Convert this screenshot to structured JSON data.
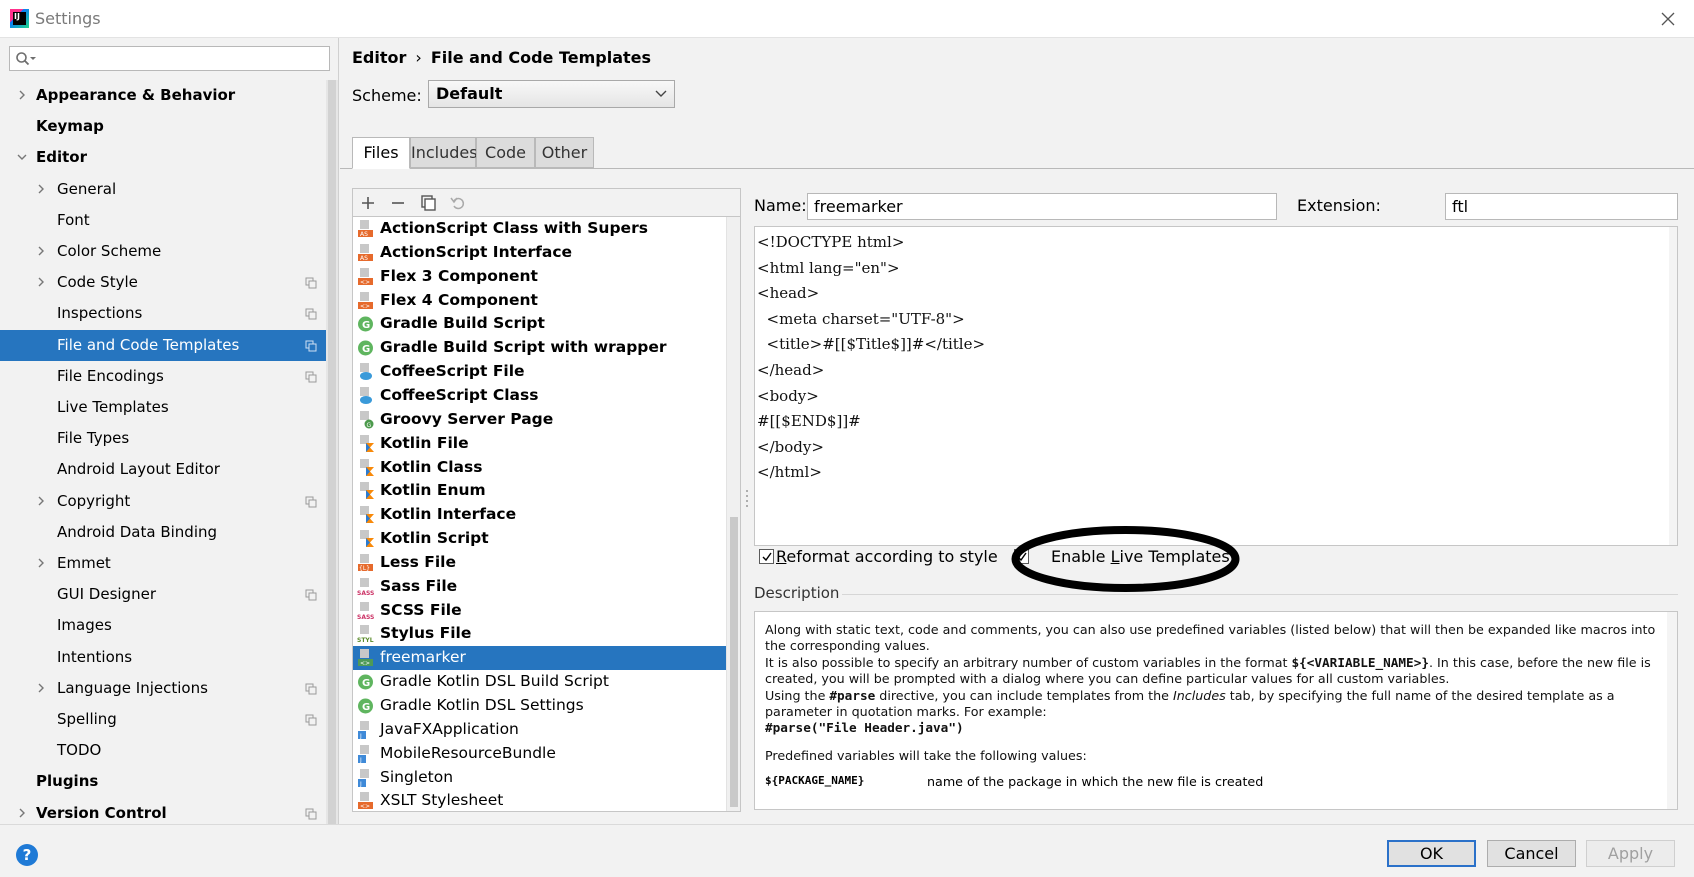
{
  "window": {
    "title": "Settings"
  },
  "search": {
    "placeholder": ""
  },
  "sidebar": {
    "items": [
      {
        "label": "Appearance & Behavior",
        "level": 0,
        "arrow": "right",
        "bold": true,
        "scoped": false,
        "selected": false
      },
      {
        "label": "Keymap",
        "level": 0,
        "arrow": "",
        "bold": true,
        "scoped": false,
        "selected": false
      },
      {
        "label": "Editor",
        "level": 0,
        "arrow": "down",
        "bold": true,
        "scoped": false,
        "selected": false
      },
      {
        "label": "General",
        "level": 1,
        "arrow": "right",
        "bold": false,
        "scoped": false,
        "selected": false
      },
      {
        "label": "Font",
        "level": 1,
        "arrow": "",
        "bold": false,
        "scoped": false,
        "selected": false
      },
      {
        "label": "Color Scheme",
        "level": 1,
        "arrow": "right",
        "bold": false,
        "scoped": false,
        "selected": false
      },
      {
        "label": "Code Style",
        "level": 1,
        "arrow": "right",
        "bold": false,
        "scoped": true,
        "selected": false
      },
      {
        "label": "Inspections",
        "level": 1,
        "arrow": "",
        "bold": false,
        "scoped": true,
        "selected": false
      },
      {
        "label": "File and Code Templates",
        "level": 1,
        "arrow": "",
        "bold": false,
        "scoped": true,
        "selected": true
      },
      {
        "label": "File Encodings",
        "level": 1,
        "arrow": "",
        "bold": false,
        "scoped": true,
        "selected": false
      },
      {
        "label": "Live Templates",
        "level": 1,
        "arrow": "",
        "bold": false,
        "scoped": false,
        "selected": false
      },
      {
        "label": "File Types",
        "level": 1,
        "arrow": "",
        "bold": false,
        "scoped": false,
        "selected": false
      },
      {
        "label": "Android Layout Editor",
        "level": 1,
        "arrow": "",
        "bold": false,
        "scoped": false,
        "selected": false
      },
      {
        "label": "Copyright",
        "level": 1,
        "arrow": "right",
        "bold": false,
        "scoped": true,
        "selected": false
      },
      {
        "label": "Android Data Binding",
        "level": 1,
        "arrow": "",
        "bold": false,
        "scoped": false,
        "selected": false
      },
      {
        "label": "Emmet",
        "level": 1,
        "arrow": "right",
        "bold": false,
        "scoped": false,
        "selected": false
      },
      {
        "label": "GUI Designer",
        "level": 1,
        "arrow": "",
        "bold": false,
        "scoped": true,
        "selected": false
      },
      {
        "label": "Images",
        "level": 1,
        "arrow": "",
        "bold": false,
        "scoped": false,
        "selected": false
      },
      {
        "label": "Intentions",
        "level": 1,
        "arrow": "",
        "bold": false,
        "scoped": false,
        "selected": false
      },
      {
        "label": "Language Injections",
        "level": 1,
        "arrow": "right",
        "bold": false,
        "scoped": true,
        "selected": false
      },
      {
        "label": "Spelling",
        "level": 1,
        "arrow": "",
        "bold": false,
        "scoped": true,
        "selected": false
      },
      {
        "label": "TODO",
        "level": 1,
        "arrow": "",
        "bold": false,
        "scoped": false,
        "selected": false
      },
      {
        "label": "Plugins",
        "level": 0,
        "arrow": "",
        "bold": true,
        "scoped": false,
        "selected": false
      },
      {
        "label": "Version Control",
        "level": 0,
        "arrow": "right",
        "bold": true,
        "scoped": true,
        "selected": false
      }
    ]
  },
  "breadcrumb": {
    "parent": "Editor",
    "separator": "›",
    "current": "File and Code Templates"
  },
  "scheme": {
    "label": "Scheme:",
    "value": "Default"
  },
  "tabs": [
    {
      "label": "Files",
      "active": true
    },
    {
      "label": "Includes",
      "active": false
    },
    {
      "label": "Code",
      "active": false
    },
    {
      "label": "Other",
      "active": false
    }
  ],
  "templates": [
    {
      "name": "ActionScript Class with Supers",
      "icon": "actionscript-icon",
      "bold": true,
      "selected": false
    },
    {
      "name": "ActionScript Interface",
      "icon": "actionscript-icon",
      "bold": true,
      "selected": false
    },
    {
      "name": "Flex 3 Component",
      "icon": "flex-icon",
      "bold": true,
      "selected": false
    },
    {
      "name": "Flex 4 Component",
      "icon": "flex-icon",
      "bold": true,
      "selected": false
    },
    {
      "name": "Gradle Build Script",
      "icon": "gradle-icon",
      "bold": true,
      "selected": false
    },
    {
      "name": "Gradle Build Script with wrapper",
      "icon": "gradle-icon",
      "bold": true,
      "selected": false
    },
    {
      "name": "CoffeeScript File",
      "icon": "coffeescript-icon",
      "bold": true,
      "selected": false
    },
    {
      "name": "CoffeeScript Class",
      "icon": "coffeescript-icon",
      "bold": true,
      "selected": false
    },
    {
      "name": "Groovy Server Page",
      "icon": "groovy-icon",
      "bold": true,
      "selected": false
    },
    {
      "name": "Kotlin File",
      "icon": "kotlin-icon",
      "bold": true,
      "selected": false
    },
    {
      "name": "Kotlin Class",
      "icon": "kotlin-icon",
      "bold": true,
      "selected": false
    },
    {
      "name": "Kotlin Enum",
      "icon": "kotlin-icon",
      "bold": true,
      "selected": false
    },
    {
      "name": "Kotlin Interface",
      "icon": "kotlin-icon",
      "bold": true,
      "selected": false
    },
    {
      "name": "Kotlin Script",
      "icon": "kotlin-icon",
      "bold": true,
      "selected": false
    },
    {
      "name": "Less File",
      "icon": "less-icon",
      "bold": true,
      "selected": false
    },
    {
      "name": "Sass File",
      "icon": "sass-icon",
      "bold": true,
      "selected": false
    },
    {
      "name": "SCSS File",
      "icon": "sass-icon",
      "bold": true,
      "selected": false
    },
    {
      "name": "Stylus File",
      "icon": "stylus-icon",
      "bold": true,
      "selected": false
    },
    {
      "name": "freemarker",
      "icon": "template-icon",
      "bold": false,
      "selected": true
    },
    {
      "name": "Gradle Kotlin DSL Build Script",
      "icon": "gradle-icon",
      "bold": false,
      "selected": false
    },
    {
      "name": "Gradle Kotlin DSL Settings",
      "icon": "gradle-icon",
      "bold": false,
      "selected": false
    },
    {
      "name": "JavaFXApplication",
      "icon": "java-icon",
      "bold": false,
      "selected": false
    },
    {
      "name": "MobileResourceBundle",
      "icon": "java-icon",
      "bold": false,
      "selected": false
    },
    {
      "name": "Singleton",
      "icon": "java-icon",
      "bold": false,
      "selected": false
    },
    {
      "name": "XSLT Stylesheet",
      "icon": "xslt-icon",
      "bold": false,
      "selected": false
    }
  ],
  "editor_form": {
    "name_label": "Name:",
    "name_value": "freemarker",
    "extension_label": "Extension:",
    "extension_value": "ftl",
    "code_lines": [
      "<!DOCTYPE html>",
      "<html lang=\"en\">",
      "<head>",
      "  <meta charset=\"UTF-8\">",
      "  <title>#[[$Title$]]#</title>",
      "</head>",
      "<body>",
      "#[[$END$]]#",
      "</body>",
      "</html>"
    ],
    "reformat_label_pre": "",
    "reformat_mnemonic": "R",
    "reformat_label_post": "eformat according to style",
    "reformat_checked": true,
    "live_templates_label_pre": "Enable ",
    "live_templates_mnemonic": "L",
    "live_templates_label_post": "ive Templates",
    "live_templates_checked": true
  },
  "description": {
    "header": "Description",
    "p1": "Along with static text, code and comments, you can also use predefined variables (listed below) that will then be expanded like macros into the corresponding values.",
    "p2_pre": "It is also possible to specify an arbitrary number of custom variables in the format ",
    "p2_code": "${<VARIABLE_NAME>}",
    "p2_post": ". In this case, before the new file is created, you will be prompted with a dialog where you can define particular values for all custom variables.",
    "p3_pre": "Using the ",
    "p3_code": "#parse",
    "p3_mid": " directive, you can include templates from the ",
    "p3_italic": "Includes",
    "p3_post": " tab, by specifying the full name of the desired template as a parameter in quotation marks. For example:",
    "p3_example": "#parse(\"File Header.java\")",
    "p4": "Predefined variables will take the following values:",
    "var_name": "${PACKAGE_NAME}",
    "var_desc": "name of the package in which the new file is created"
  },
  "buttons": {
    "ok": "OK",
    "cancel": "Cancel",
    "apply": "Apply",
    "help": "?"
  },
  "colors": {
    "selection": "#2675bf",
    "highlight_ellipse": "#000000",
    "accent_blue": "#1f7ad6"
  }
}
